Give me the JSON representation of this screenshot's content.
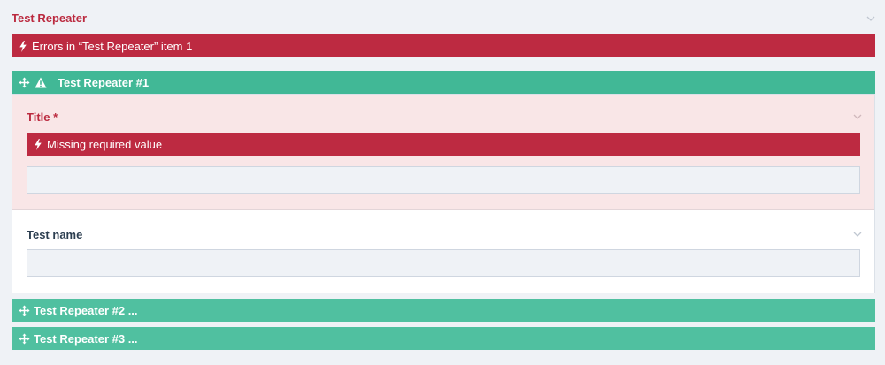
{
  "repeater": {
    "title": "Test Repeater",
    "error_summary": "Errors in “Test Repeater” item 1",
    "items": [
      {
        "label": "Test Repeater #1",
        "expanded": true,
        "has_error": true,
        "fields": {
          "title": {
            "label": "Title *",
            "error": "Missing required value",
            "value": ""
          },
          "test_name": {
            "label": "Test name",
            "value": ""
          }
        }
      },
      {
        "label": "Test Repeater #2 ...",
        "expanded": false
      },
      {
        "label": "Test Repeater #3 ...",
        "expanded": false
      }
    ]
  },
  "icons": {
    "error": "lightning-bolt-icon",
    "warning": "warning-triangle-icon",
    "drag": "move-arrows-icon",
    "collapse": "chevron-down-icon"
  },
  "colors": {
    "error_red": "#bd2a41",
    "label_red": "#bb2a3f",
    "header_green": "#41b896",
    "collapsed_green": "#50c0a0",
    "error_bg": "#f9e6e7",
    "page_bg": "#eff2f6"
  }
}
